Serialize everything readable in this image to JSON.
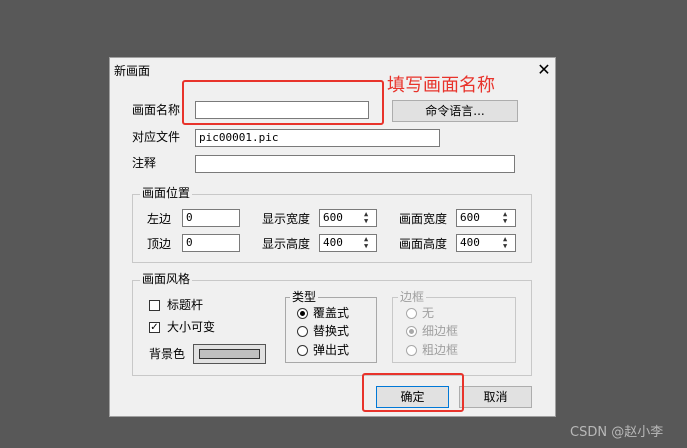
{
  "dialog": {
    "title": "新画面",
    "close_symbol": "✕",
    "name_label": "画面名称",
    "name_value": "",
    "command_button": "命令语言...",
    "file_label": "对应文件",
    "file_value": "pic00001.pic",
    "comment_label": "注释",
    "comment_value": "",
    "position_group": {
      "title": "画面位置",
      "left_label": "左边",
      "left_value": "0",
      "top_label": "顶边",
      "top_value": "0",
      "display_width_label": "显示宽度",
      "display_width_value": "600",
      "display_height_label": "显示高度",
      "display_height_value": "400",
      "screen_width_label": "画面宽度",
      "screen_width_value": "600",
      "screen_height_label": "画面高度",
      "screen_height_value": "400"
    },
    "style_group": {
      "title": "画面风格",
      "title_bar_label": "标题杆",
      "title_bar_checked": false,
      "resizable_label": "大小可变",
      "resizable_checked": true,
      "bg_color_label": "背景色",
      "type_group": {
        "title": "类型",
        "options": [
          "覆盖式",
          "替换式",
          "弹出式"
        ],
        "selected": "覆盖式"
      },
      "border_group": {
        "title": "边框",
        "options": [
          "无",
          "细边框",
          "粗边框"
        ],
        "selected": "细边框",
        "enabled": false
      }
    },
    "ok_button": "确定",
    "cancel_button": "取消"
  },
  "annotation": {
    "text": "填写画面名称",
    "color": "#e8332b"
  },
  "watermark": "CSDN @赵小李",
  "spin_up": "▲",
  "spin_down": "▼",
  "check_mark": "✓"
}
